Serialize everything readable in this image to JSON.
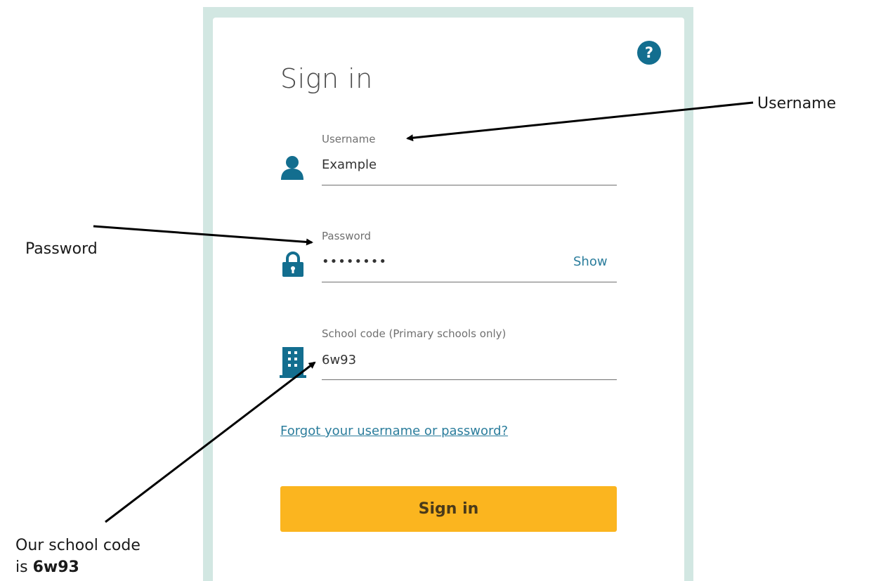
{
  "dialog": {
    "title": "Sign in",
    "help_icon_glyph": "?",
    "help_icon": "help-circle-icon"
  },
  "fields": {
    "username": {
      "label": "Username",
      "value": "Example",
      "icon": "user-icon"
    },
    "password": {
      "label": "Password",
      "value": "••••••••",
      "show_label": "Show",
      "icon": "lock-icon"
    },
    "school_code": {
      "label": "School code (Primary schools only)",
      "value": "6w93",
      "icon": "building-icon"
    }
  },
  "links": {
    "forgot": "Forgot your username or password?"
  },
  "buttons": {
    "sign_in": "Sign in"
  },
  "annotations": {
    "username": "Username",
    "password": "Password",
    "school_code_prefix": "Our school code",
    "school_code_is": "is ",
    "school_code_value": "6w93"
  },
  "colors": {
    "frame": "#d2e7e2",
    "accent": "#136e8f",
    "link": "#2b7d9c",
    "button": "#fbb51f"
  }
}
